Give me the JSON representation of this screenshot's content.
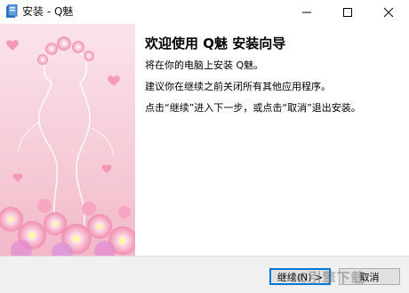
{
  "window": {
    "title": "安装 - Q魅"
  },
  "content": {
    "heading": "欢迎使用 Q魅 安装向导",
    "line1": "将在你的电脑上安装 Q魅。",
    "line2": "建议你在继续之前关闭所有其他应用程序。",
    "line3": "点击“继续”进入下一步，或点击“取消”退出安装。"
  },
  "buttons": {
    "next": "继续(N) >",
    "cancel": "取消"
  },
  "watermark": "IC引擎下载",
  "colors": {
    "art_bg": "#f7d3dc",
    "accent": "#0078d7"
  }
}
